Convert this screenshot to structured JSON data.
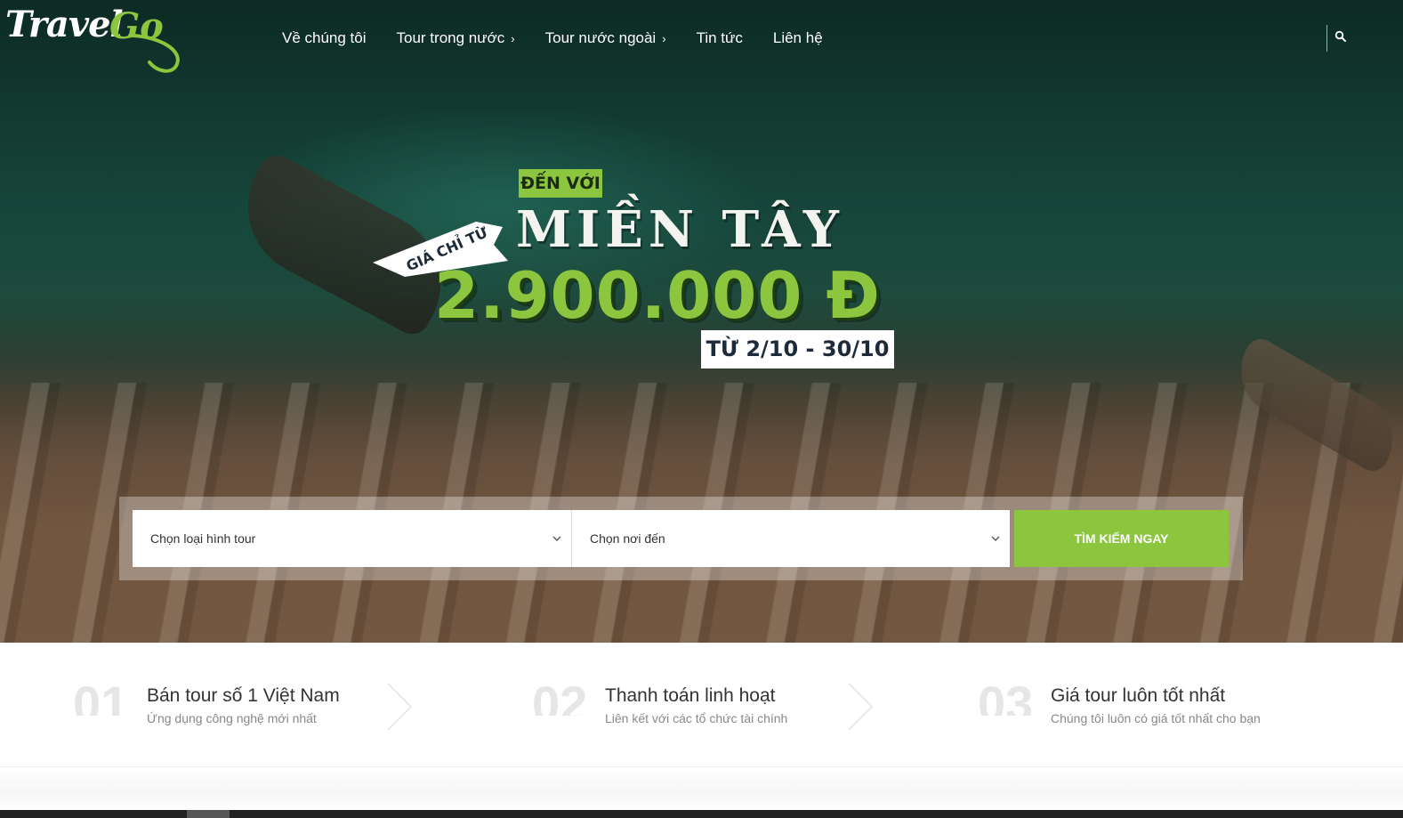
{
  "logo": {
    "part1": "Travel",
    "part2": "Go"
  },
  "nav": {
    "items": [
      {
        "label": "Về chúng tôi",
        "has_submenu": false
      },
      {
        "label": "Tour trong nước",
        "has_submenu": true
      },
      {
        "label": "Tour nước ngoài",
        "has_submenu": true
      },
      {
        "label": "Tin tức",
        "has_submenu": false
      },
      {
        "label": "Liên hệ",
        "has_submenu": false
      }
    ],
    "search_icon": "search-icon"
  },
  "promo": {
    "den_voi": "ĐẾN VỚI",
    "destination": "MIỀN TÂY",
    "ribbon": "GIÁ CHỈ TỪ",
    "price": "2.900.000 Đ",
    "dates": "TỪ  2/10 - 30/10"
  },
  "search": {
    "tour_type_placeholder": "Chọn loại hình tour",
    "destination_placeholder": "Chọn nơi đến",
    "button_label": "TÌM KIẾM NGAY"
  },
  "features": [
    {
      "number": "01",
      "title": "Bán tour số 1 Việt Nam",
      "subtitle": "Ứng dụng công nghệ mới nhất"
    },
    {
      "number": "02",
      "title": "Thanh toán linh hoạt",
      "subtitle": "Liên kết với các tổ chức tài chính"
    },
    {
      "number": "03",
      "title": "Giá tour luôn tốt nhất",
      "subtitle": "Chúng tôi luôn có giá tốt nhất cho bạn"
    }
  ],
  "colors": {
    "accent": "#8cc63f",
    "text_dark": "#333333",
    "text_muted": "#888888"
  }
}
